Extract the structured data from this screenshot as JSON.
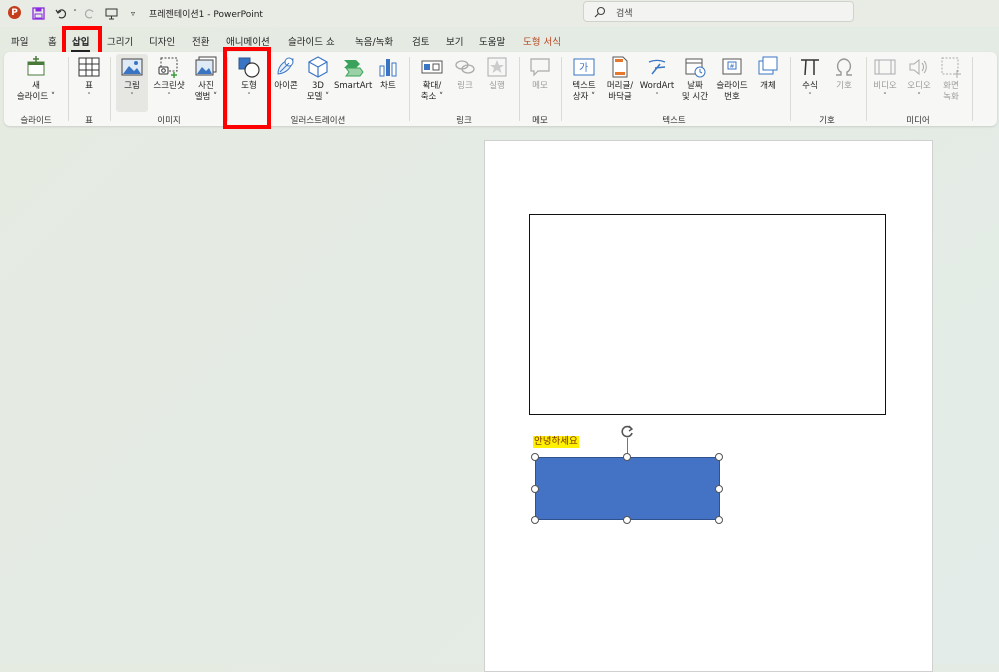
{
  "app": {
    "logo_letter": "P",
    "document_title": "프레젠테이션1  -  PowerPoint",
    "search_placeholder": "검색"
  },
  "tabs": [
    {
      "label": "파일"
    },
    {
      "label": "홈"
    },
    {
      "label": "삽입"
    },
    {
      "label": "그리기"
    },
    {
      "label": "디자인"
    },
    {
      "label": "전환"
    },
    {
      "label": "애니메이션"
    },
    {
      "label": "슬라이드 쇼"
    },
    {
      "label": "녹음/녹화"
    },
    {
      "label": "검토"
    },
    {
      "label": "보기"
    },
    {
      "label": "도움말"
    },
    {
      "label": "도형 서식"
    }
  ],
  "ribbon": {
    "new_slide": {
      "line1": "새",
      "line2": "슬라이드 ˅"
    },
    "table": {
      "label": "표"
    },
    "picture": {
      "label": "그림"
    },
    "screenshot": {
      "label": "스크린샷"
    },
    "photo_album": {
      "line1": "사진",
      "line2": "앨범 ˅"
    },
    "shapes": {
      "label": "도형"
    },
    "icons": {
      "label": "아이콘"
    },
    "model3d": {
      "line1": "3D",
      "line2": "모델 ˅"
    },
    "smartart": {
      "label": "SmartArt"
    },
    "chart": {
      "label": "차트"
    },
    "zoom": {
      "line1": "확대/",
      "line2": "축소 ˅"
    },
    "link": {
      "label": "링크"
    },
    "action": {
      "label": "실행"
    },
    "comment": {
      "label": "메모"
    },
    "textbox": {
      "line1": "텍스트",
      "line2": "상자 ˅"
    },
    "header_footer": {
      "line1": "머리글/",
      "line2": "바닥글"
    },
    "wordart": {
      "label": "WordArt"
    },
    "datetime": {
      "line1": "날짜",
      "line2": "및 시간"
    },
    "slide_number": {
      "line1": "슬라이드",
      "line2": "번호"
    },
    "object": {
      "label": "개체"
    },
    "equation": {
      "label": "수식"
    },
    "symbol": {
      "label": "기호"
    },
    "video": {
      "label": "비디오"
    },
    "audio": {
      "label": "오디오"
    },
    "screen_record": {
      "line1": "화면",
      "line2": "녹화"
    }
  },
  "groups": {
    "slides": "슬라이드",
    "table": "표",
    "images": "이미지",
    "illustrations": "일러스트레이션",
    "links": "링크",
    "comments": "메모",
    "text": "텍스트",
    "symbols": "기호",
    "media": "미디어"
  },
  "slide": {
    "text_label": "안녕하세요"
  },
  "colors": {
    "accent": "#b8451d",
    "highlight_box": "#ff0000",
    "shape_fill": "#4472c4",
    "text_highlight": "#fff200"
  }
}
